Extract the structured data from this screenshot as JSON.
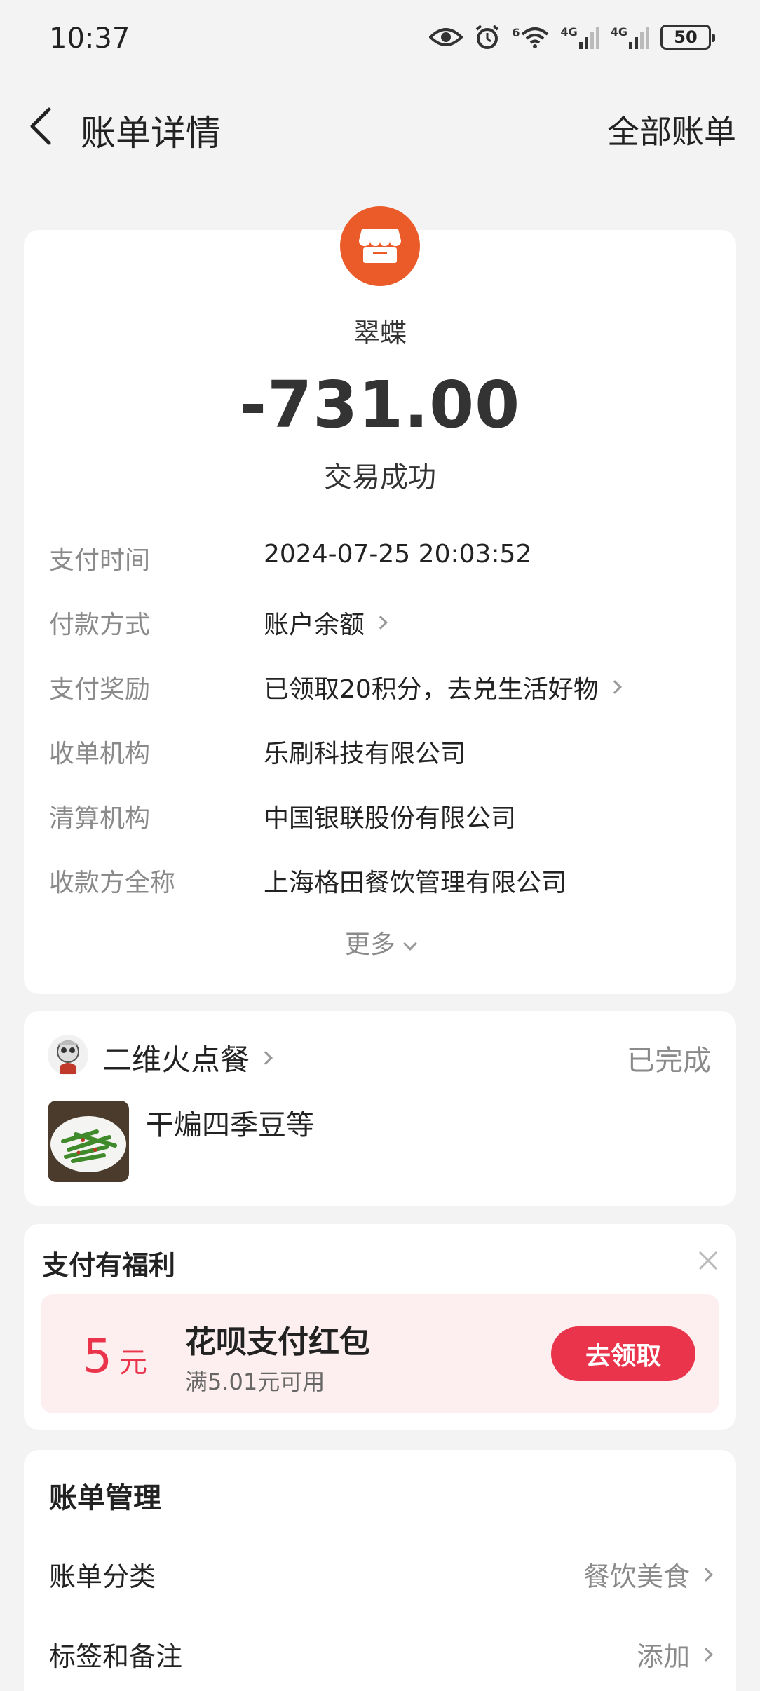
{
  "status_bar": {
    "time": "10:37",
    "signal1_label": "4G",
    "signal2_label": "4G",
    "wifi_label": "6",
    "battery": "50"
  },
  "nav": {
    "title": "账单详情",
    "all_bills": "全部账单"
  },
  "transaction": {
    "merchant": "翠蝶",
    "amount": "-731.00",
    "status": "交易成功",
    "details": [
      {
        "label": "支付时间",
        "value": "2024-07-25 20:03:52"
      },
      {
        "label": "付款方式",
        "value": "账户余额"
      },
      {
        "label": "支付奖励",
        "value": "已领取20积分，去兑生活好物"
      },
      {
        "label": "收单机构",
        "value": "乐刷科技有限公司"
      },
      {
        "label": "清算机构",
        "value": "中国银联股份有限公司"
      },
      {
        "label": "收款方全称",
        "value": "上海格田餐饮管理有限公司"
      }
    ],
    "more": "更多"
  },
  "order": {
    "shop": "二维火点餐",
    "status": "已完成",
    "dish": "干煸四季豆等"
  },
  "benefit": {
    "title": "支付有福利",
    "coupon_amount": "5",
    "coupon_unit": "元",
    "coupon_title": "花呗支付红包",
    "coupon_condition": "满5.01元可用",
    "claim_button": "去领取"
  },
  "manage": {
    "title": "账单管理",
    "rows": [
      {
        "label": "账单分类",
        "value": "餐饮美食"
      },
      {
        "label": "标签和备注",
        "value": "添加"
      }
    ]
  },
  "colors": {
    "accent_red": "#e9344b",
    "merchant_orange": "#ea5b29",
    "background": "#f3f3f3"
  }
}
